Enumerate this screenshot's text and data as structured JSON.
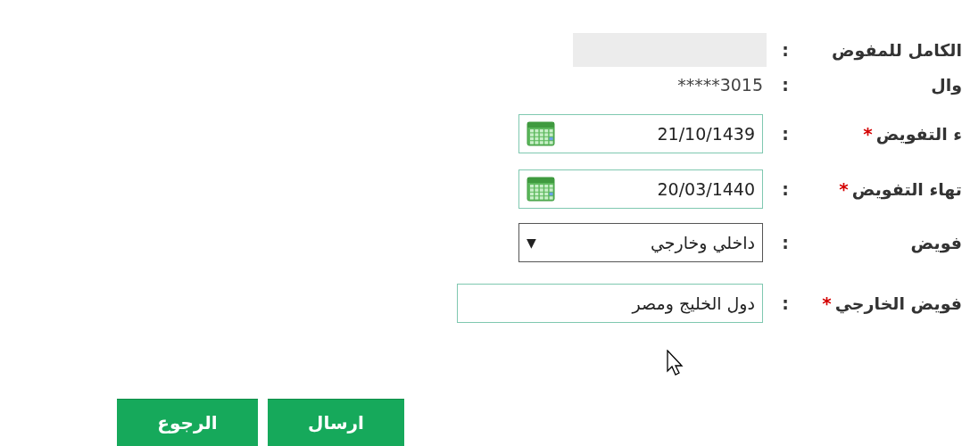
{
  "form": {
    "rows": [
      {
        "kind": "blank",
        "label": "الكامل للمفوض",
        "colon": ":"
      },
      {
        "kind": "text",
        "label": "وال",
        "colon": ":",
        "value": "*****3015"
      },
      {
        "kind": "date",
        "label": "ء التفويض",
        "required_mark": "*",
        "colon": ":",
        "value": "21/10/1439"
      },
      {
        "kind": "date",
        "label": "تهاء التفويض",
        "required_mark": "*",
        "colon": ":",
        "value": "20/03/1440"
      },
      {
        "kind": "select",
        "label": "فويض",
        "colon": ":",
        "value": "داخلي وخارجي",
        "arrow": "▼"
      },
      {
        "kind": "input",
        "label": "فويض الخارجي",
        "required_mark": "*",
        "colon": ":",
        "value": "دول الخليج ومصر"
      }
    ]
  },
  "buttons": [
    {
      "label": "ارسال"
    },
    {
      "label": "الرجوع"
    }
  ]
}
